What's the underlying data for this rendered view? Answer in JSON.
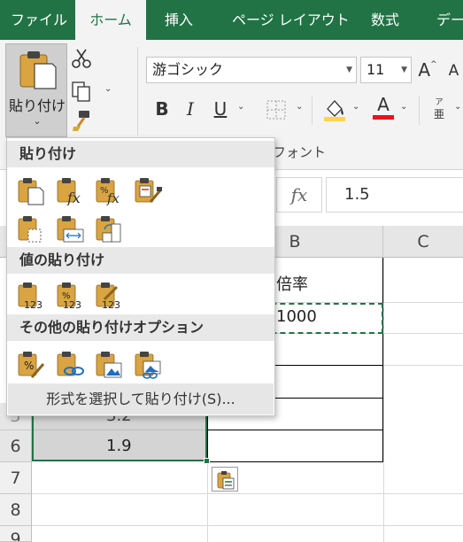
{
  "tabs": [
    {
      "label": "ファイル",
      "active": false
    },
    {
      "label": "ホーム",
      "active": true
    },
    {
      "label": "挿入",
      "active": false
    },
    {
      "label": "ページ レイアウト",
      "active": false
    },
    {
      "label": "数式",
      "active": false
    },
    {
      "label": "デー",
      "active": false
    }
  ],
  "ribbon": {
    "paste_label": "貼り付け",
    "font_name": "游ゴシック",
    "font_size": "11",
    "bold": "B",
    "italic": "I",
    "underline": "U",
    "font_group_label": "フォント",
    "font_color": "#e81123",
    "fill_color": "#ffd54a",
    "accent": "#217346"
  },
  "formula_bar": {
    "fx": "fx",
    "value": "1.5"
  },
  "grid": {
    "columns": [
      "B",
      "C"
    ],
    "rows": [
      "5",
      "6",
      "7",
      "8",
      "9"
    ],
    "cells": {
      "b_header": "倍率",
      "b_value": "1000",
      "a5": "3.2",
      "a6": "1.9"
    }
  },
  "paste_menu": {
    "sections": [
      {
        "title": "貼り付け",
        "icons": [
          "paste-icon",
          "paste-formulas-icon",
          "paste-formulas-number-format-icon",
          "keep-source-formatting-icon",
          "no-borders-icon",
          "keep-column-widths-icon",
          "transpose-icon"
        ]
      },
      {
        "title": "値の貼り付け",
        "icons": [
          "paste-values-icon",
          "values-number-format-icon",
          "values-source-formatting-icon"
        ]
      },
      {
        "title": "その他の貼り付けオプション",
        "icons": [
          "formatting-icon",
          "paste-link-icon",
          "picture-icon",
          "linked-picture-icon"
        ]
      }
    ],
    "paste_special": "形式を選択して貼り付け(S)..."
  }
}
